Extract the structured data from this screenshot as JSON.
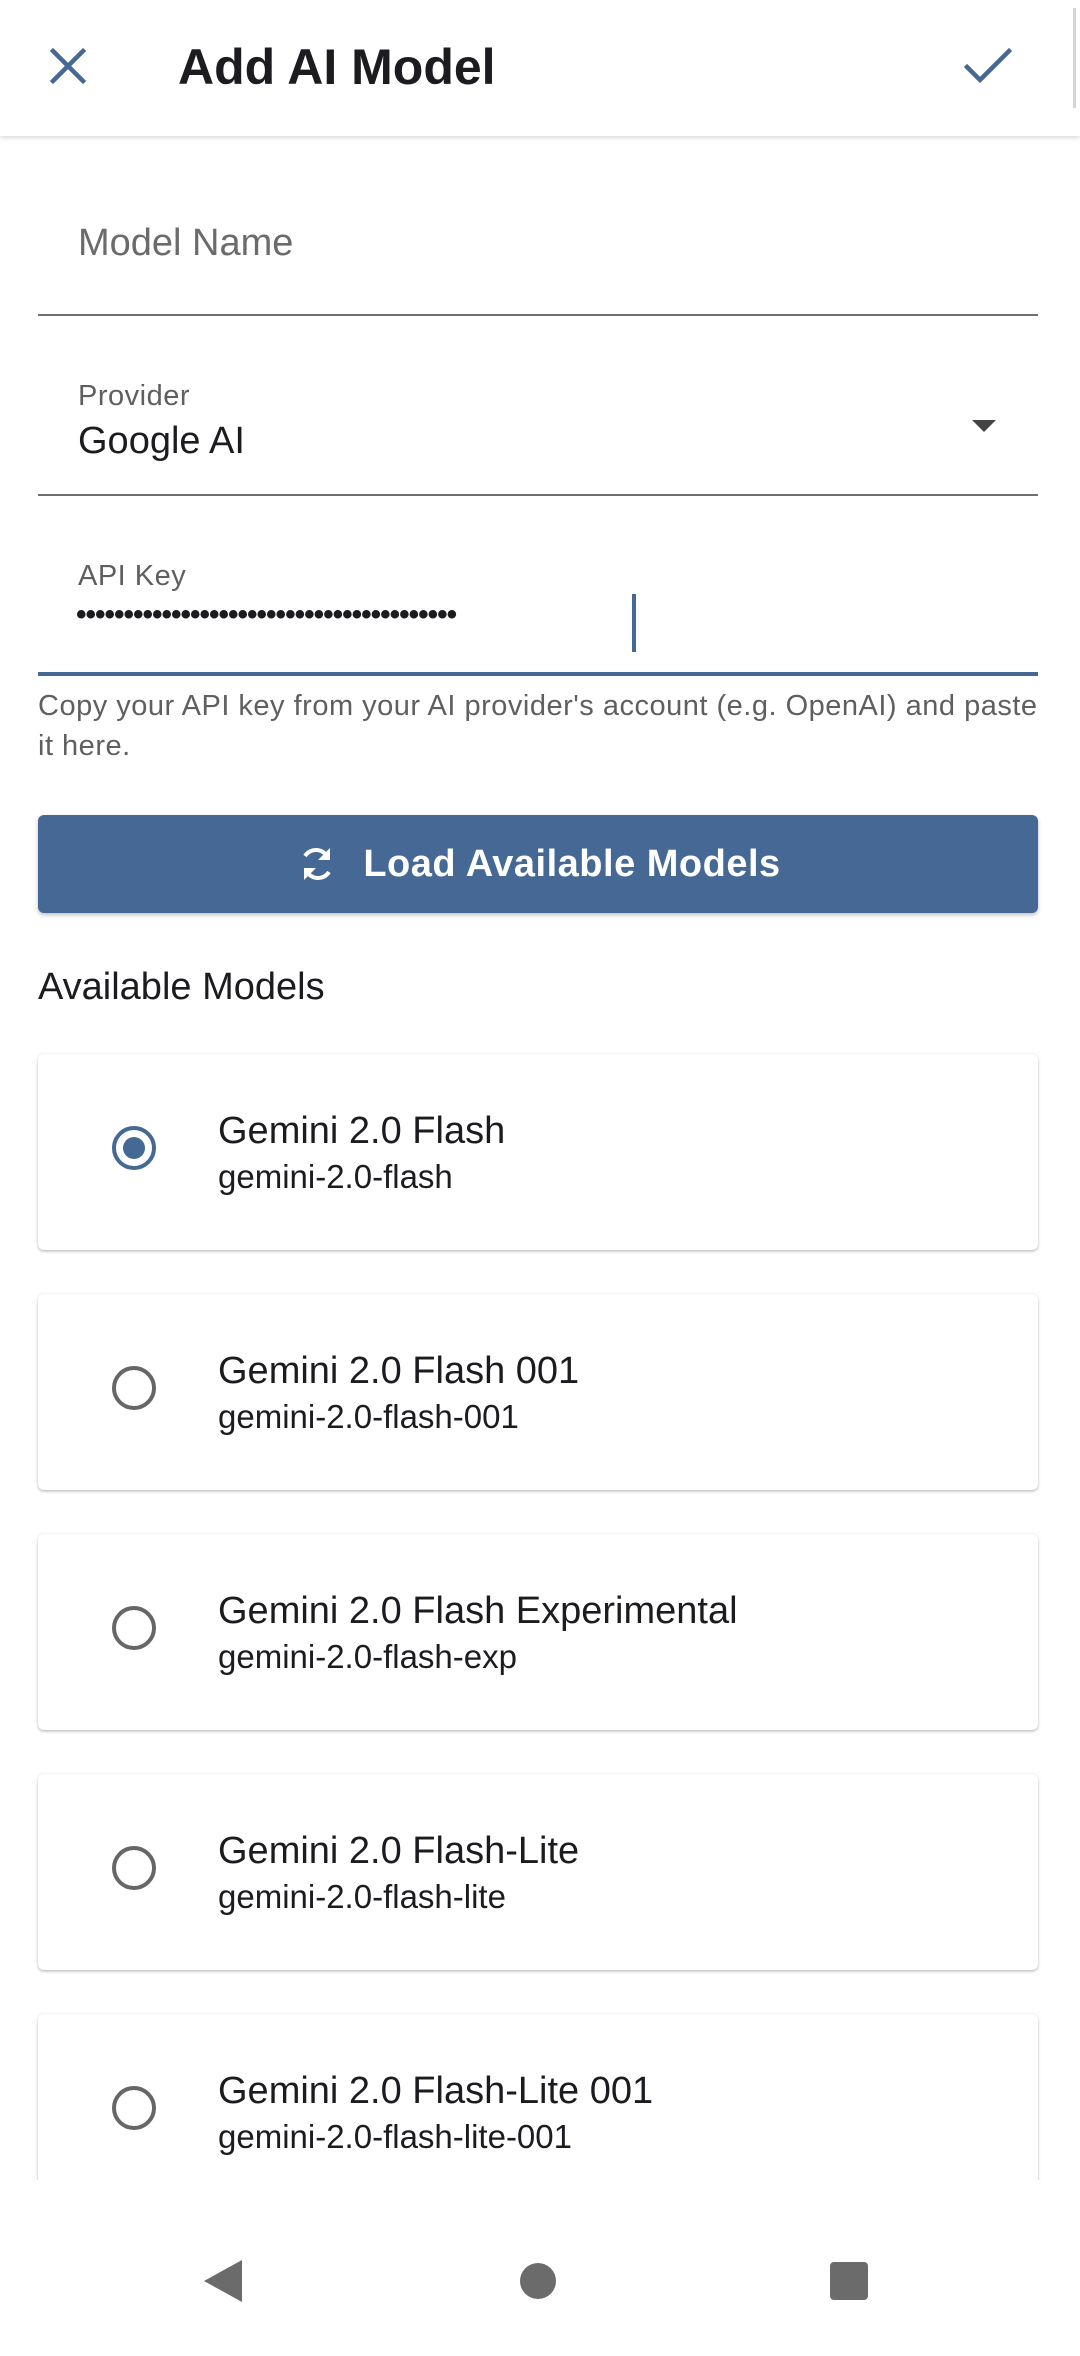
{
  "app_bar": {
    "title": "Add AI Model",
    "close_icon": "close-icon",
    "confirm_icon": "check-icon"
  },
  "form": {
    "model_name": {
      "placeholder": "Model Name",
      "value": ""
    },
    "provider": {
      "label": "Provider",
      "value": "Google AI"
    },
    "api_key": {
      "label": "API Key",
      "masked_value": "••••••••••••••••••••••••••••••••••••••••",
      "helper": "Copy your API key from your AI provider's account (e.g. OpenAI) and paste it here."
    }
  },
  "load_button": {
    "label": "Load Available Models",
    "icon": "refresh-icon"
  },
  "available_models": {
    "title": "Available Models",
    "items": [
      {
        "name": "Gemini 2.0 Flash",
        "id": "gemini-2.0-flash",
        "selected": true
      },
      {
        "name": "Gemini 2.0 Flash 001",
        "id": "gemini-2.0-flash-001",
        "selected": false
      },
      {
        "name": "Gemini 2.0 Flash Experimental",
        "id": "gemini-2.0-flash-exp",
        "selected": false
      },
      {
        "name": "Gemini 2.0 Flash-Lite",
        "id": "gemini-2.0-flash-lite",
        "selected": false
      },
      {
        "name": "Gemini 2.0 Flash-Lite 001",
        "id": "gemini-2.0-flash-lite-001",
        "selected": false
      }
    ]
  },
  "colors": {
    "accent": "#456994",
    "text": "#1c1b1f",
    "secondary_text": "#5f5f5f",
    "nav_icon": "#6b6b6b"
  },
  "nav_bar": {
    "back_icon": "back-triangle-icon",
    "home_icon": "home-circle-icon",
    "recents_icon": "recents-square-icon"
  }
}
